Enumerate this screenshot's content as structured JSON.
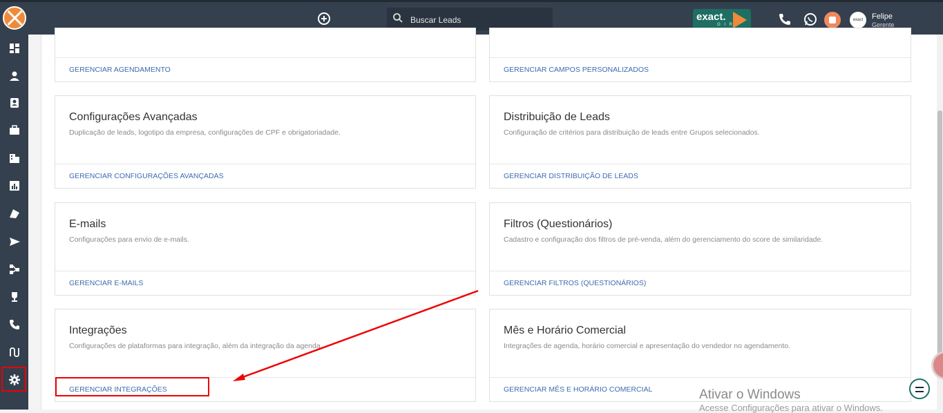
{
  "topbar": {
    "search_placeholder": "Buscar Leads",
    "brand": "exact.",
    "brand_sub": "O I R",
    "user_name": "Felipe",
    "user_role": "Gerente",
    "avatar_text": "exact"
  },
  "cards": [
    {
      "title": "",
      "desc": "",
      "link": "GERENCIAR AGENDAMENTO"
    },
    {
      "title": "",
      "desc": "",
      "link": "GERENCIAR CAMPOS PERSONALIZADOS"
    },
    {
      "title": "Configurações Avançadas",
      "desc": "Duplicação de leads, logotipo da empresa, configurações de CPF e obrigatoriadade.",
      "link": "GERENCIAR CONFIGURAÇÕES AVANÇADAS"
    },
    {
      "title": "Distribuição de Leads",
      "desc": "Configuração de critérios para distribuição de leads entre Grupos selecionados.",
      "link": "GERENCIAR DISTRIBUIÇÃO DE LEADS"
    },
    {
      "title": "E-mails",
      "desc": "Configurações para envio de e-mails.",
      "link": "GERENCIAR E-MAILS"
    },
    {
      "title": "Filtros (Questionários)",
      "desc": "Cadastro e configuração dos filtros de pré-venda, além do gerenciamento do score de similaridade.",
      "link": "GERENCIAR FILTROS (QUESTIONÁRIOS)"
    },
    {
      "title": "Integrações",
      "desc": "Configurações de plataformas para integração, além da integração da agenda.",
      "link": "GERENCIAR INTEGRAÇÕES"
    },
    {
      "title": "Mês e Horário Comercial",
      "desc": "Integrações de agenda, horário comercial e apresentação do vendedor no agendamento.",
      "link": "GERENCIAR MÊS E HORÁRIO COMERCIAL"
    }
  ],
  "sidebar": {
    "icons": [
      "dashboard-icon",
      "person-icon",
      "contact-card-icon",
      "briefcase-icon",
      "building-icon",
      "chart-icon",
      "pipeline-icon",
      "send-icon",
      "hierarchy-icon",
      "trophy-icon",
      "phone-icon",
      "route-icon",
      "gear-icon"
    ],
    "active": "gear-icon"
  },
  "watermark": {
    "line1": "Ativar o Windows",
    "line2": "Acesse Configurações para ativar o Windows."
  },
  "colors": {
    "topbar": "#34404e",
    "link": "#3d6bb0",
    "highlight": "#e00000",
    "brand": "#1e6e63",
    "accent": "#ee8a3a"
  }
}
